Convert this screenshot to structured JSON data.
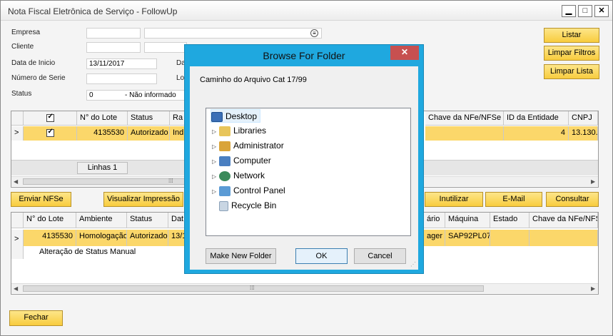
{
  "window": {
    "title": "Nota Fiscal Eletrônica de Serviço - FollowUp",
    "minimize": "▁",
    "maximize": "□",
    "close": "✕"
  },
  "form": {
    "empresa_label": "Empresa",
    "cliente_label": "Cliente",
    "data_inicio_label": "Data de Inicio",
    "data_inicio_value": "13/11/2017",
    "data_fim_label": "Da",
    "numero_serie_label": "Número de Serie",
    "lo_label": "Lo",
    "status_label": "Status",
    "status_value": "0",
    "status_desc": "- Não informado"
  },
  "side_buttons": {
    "listar": "Listar",
    "limpar_filtros": "Limpar Filtros",
    "limpar_lista": "Limpar Lista"
  },
  "grid1": {
    "headers": [
      "N° do Lote",
      "Status",
      "Ra",
      "Chave da NFe/NFSe",
      "ID da Entidade",
      "CNPJ"
    ],
    "row": {
      "lote": "4135530",
      "status": "Autorizado",
      "ra": "Ind",
      "entidade": "4",
      "cnpj": "13.130."
    },
    "footer": "Linhas 1",
    "row_marker": ">",
    "scroll_dots": "⁞⁞⁞"
  },
  "actions": {
    "enviar": "Enviar NFSe",
    "visualizar": "Visualizar Impressão",
    "inutilizar": "Inutilizar",
    "email": "E-Mail",
    "consultar": "Consultar"
  },
  "grid2": {
    "headers": [
      "N° do Lote",
      "Ambiente",
      "Status",
      "Dat",
      "ário",
      "Máquina",
      "Estado",
      "Chave da NFe/NFSe"
    ],
    "row": {
      "lote": "4135530",
      "ambiente": "Homologação",
      "status": "Autorizado",
      "dat": "13/1",
      "usuario": "ager",
      "maquina": "SAP92PL07"
    },
    "row2": "Alteração de Status Manual",
    "row_marker": ">"
  },
  "fechar": "Fechar",
  "dialog": {
    "title": "Browse For Folder",
    "close": "✕",
    "caption": "Caminho do Arquivo Cat 17/99",
    "tree": [
      "Desktop",
      "Libraries",
      "Administrator",
      "Computer",
      "Network",
      "Control Panel",
      "Recycle Bin"
    ],
    "make_new_folder": "Make New Folder",
    "ok": "OK",
    "cancel": "Cancel"
  },
  "colors": {
    "accent": "#fbd76a",
    "button": "#f8cc3e",
    "dialog_frame": "#1fa8df",
    "close_red": "#c75050"
  }
}
